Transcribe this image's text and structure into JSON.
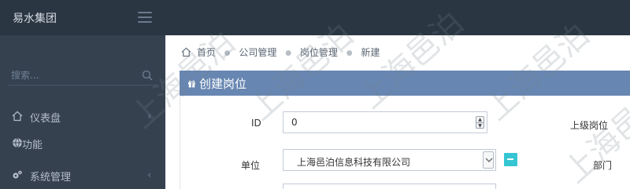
{
  "header": {
    "brand": "易水集团"
  },
  "sidebar": {
    "search_placeholder": "搜索...",
    "items": [
      {
        "label": "仪表盘",
        "icon": "home-icon",
        "has_children": true
      },
      {
        "label": "功能",
        "icon": "globe-icon",
        "has_children": false
      },
      {
        "label": "系统管理",
        "icon": "gears-icon",
        "has_children": true
      }
    ],
    "chevron": "‹"
  },
  "breadcrumb": [
    "首页",
    "公司管理",
    "岗位管理",
    "新建"
  ],
  "panel": {
    "title": "创建岗位"
  },
  "form": {
    "id_label": "ID",
    "id_value": "0",
    "parent_label": "上级岗位",
    "unit_label": "单位",
    "unit_value": "上海邑泊信息科技有限公司",
    "dept_label": "部门",
    "clear_button": "–"
  },
  "watermark": {
    "text": "上海邑泊"
  },
  "colors": {
    "topbar": "#2b3643",
    "sidebar": "#364150",
    "panel_header": "#6786b1",
    "accent": "#36c6d3"
  }
}
